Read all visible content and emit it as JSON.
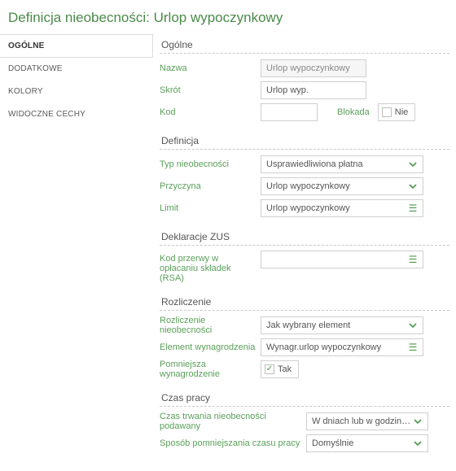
{
  "title": "Definicja nieobecności: Urlop wypoczynkowy",
  "sidebar": {
    "items": [
      {
        "label": "OGÓLNE",
        "active": true
      },
      {
        "label": "DODATKOWE",
        "active": false
      },
      {
        "label": "KOLORY",
        "active": false
      },
      {
        "label": "WIDOCZNE CECHY",
        "active": false
      }
    ]
  },
  "sections": {
    "ogolne": {
      "title": "Ogólne",
      "nazwa_label": "Nazwa",
      "nazwa_value": "Urlop wypoczynkowy",
      "skrot_label": "Skrót",
      "skrot_value": "Urlop wyp.",
      "kod_label": "Kod",
      "kod_value": "",
      "blokada_label": "Blokada",
      "blokada_value": "Nie",
      "blokada_checked": false
    },
    "definicja": {
      "title": "Definicja",
      "typ_label": "Typ nieobecności",
      "typ_value": "Usprawiedliwiona płatna",
      "przyczyna_label": "Przyczyna",
      "przyczyna_value": "Urlop wypoczynkowy",
      "limit_label": "Limit",
      "limit_value": "Urlop wypoczynkowy"
    },
    "zus": {
      "title": "Deklaracje ZUS",
      "kod_label": "Kod przerwy w opłacaniu składek (RSA)",
      "kod_value": ""
    },
    "rozliczenie": {
      "title": "Rozliczenie",
      "rozl_label": "Rozliczenie nieobecności",
      "rozl_value": "Jak wybrany element",
      "element_label": "Element wynagrodzenia",
      "element_value": "Wynagr.urlop wypoczynkowy",
      "pomn_label": "Pomniejsza wynagrodzenie",
      "pomn_value": "Tak",
      "pomn_checked": true
    },
    "czas": {
      "title": "Czas pracy",
      "czas_label": "Czas trwania nieobecności podawany",
      "czas_value": "W dniach lub w godzinach",
      "sposob_label": "Sposób pomniejszania czasu pracy",
      "sposob_value": "Domyślnie"
    }
  }
}
